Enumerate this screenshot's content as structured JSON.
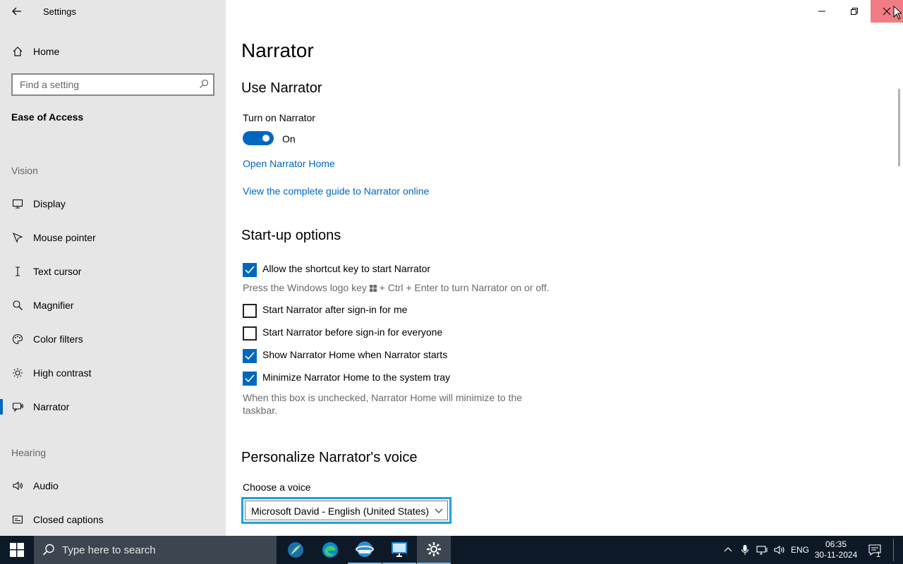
{
  "window": {
    "title": "Settings"
  },
  "sidebar": {
    "home_label": "Home",
    "search_placeholder": "Find a setting",
    "category": "Ease of Access",
    "vision_header": "Vision",
    "vision_items": [
      {
        "label": "Display",
        "icon": "monitor-icon"
      },
      {
        "label": "Mouse pointer",
        "icon": "mouse-pointer-icon"
      },
      {
        "label": "Text cursor",
        "icon": "text-cursor-icon"
      },
      {
        "label": "Magnifier",
        "icon": "magnifier-icon"
      },
      {
        "label": "Color filters",
        "icon": "palette-icon"
      },
      {
        "label": "High contrast",
        "icon": "sun-icon"
      },
      {
        "label": "Narrator",
        "icon": "narrator-icon",
        "selected": true
      }
    ],
    "hearing_header": "Hearing",
    "hearing_items": [
      {
        "label": "Audio",
        "icon": "speaker-icon"
      },
      {
        "label": "Closed captions",
        "icon": "captions-icon"
      }
    ]
  },
  "main": {
    "page_title": "Narrator",
    "use_narrator": {
      "heading": "Use Narrator",
      "toggle_label": "Turn on Narrator",
      "toggle_state": "On",
      "toggle_on": true,
      "link_home": "Open Narrator Home",
      "link_guide": "View the complete guide to Narrator online"
    },
    "startup": {
      "heading": "Start-up options",
      "options": [
        {
          "label": "Allow the shortcut key to start Narrator",
          "checked": true
        },
        {
          "label": "Start Narrator after sign-in for me",
          "checked": false
        },
        {
          "label": "Start Narrator before sign-in for everyone",
          "checked": false
        },
        {
          "label": "Show Narrator Home when Narrator starts",
          "checked": true
        },
        {
          "label": "Minimize Narrator Home to the system tray",
          "checked": true
        }
      ],
      "shortcut_help_prefix": "Press the Windows logo key",
      "shortcut_help_suffix": "+ Ctrl + Enter to turn Narrator on or off.",
      "minimize_help_line1": "When this box is unchecked, Narrator Home will minimize to the",
      "minimize_help_line2": "taskbar."
    },
    "voice": {
      "heading": "Personalize Narrator's voice",
      "choose_label": "Choose a voice",
      "selected_voice": "Microsoft David - English (United States)"
    }
  },
  "taskbar": {
    "search_placeholder": "Type here to search",
    "lang": "ENG",
    "time": "06:35",
    "date": "30-11-2024",
    "notification_count": "1"
  },
  "colors": {
    "accent": "#0067c0",
    "focus_border": "#1ba1e2",
    "sidebar_bg": "#e6e6e6",
    "taskbar_bg": "#0d1926"
  }
}
